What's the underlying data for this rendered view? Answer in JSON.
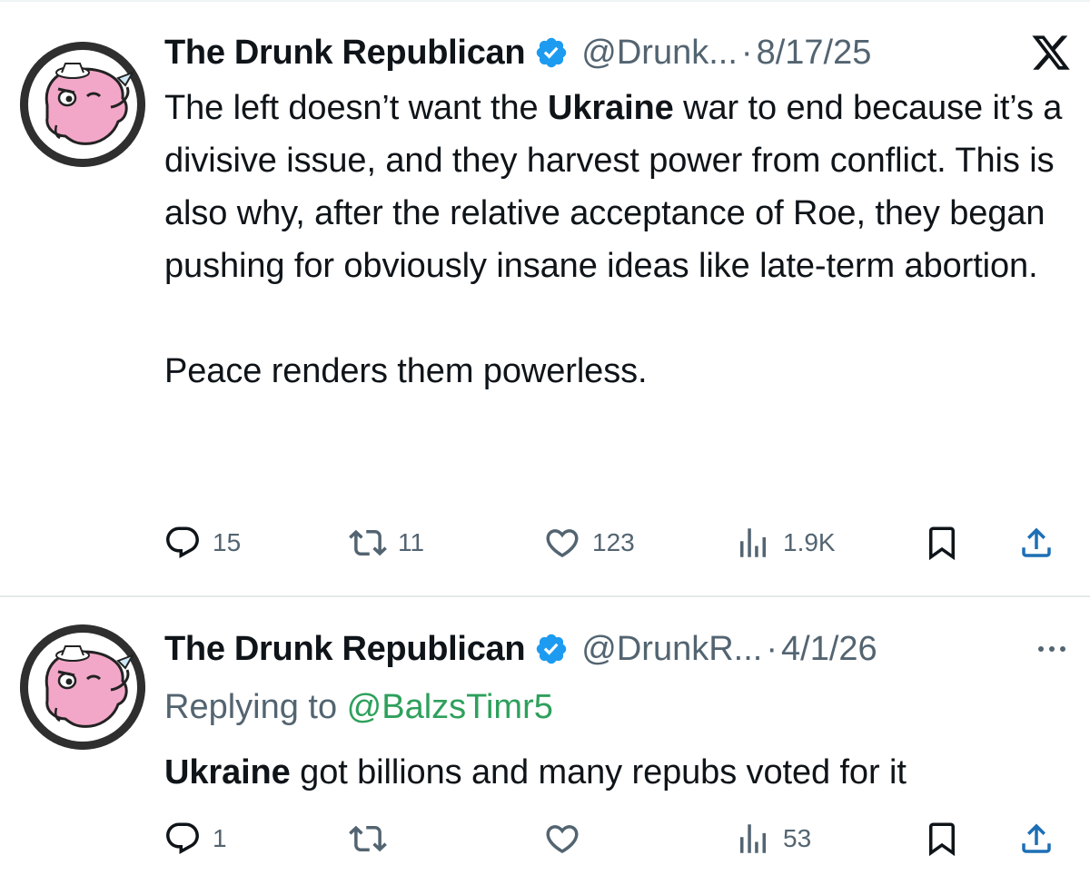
{
  "tweets": [
    {
      "author_name": "The Drunk Republican",
      "handle": "@Drunk...",
      "separator": "·",
      "date": "8/17/25",
      "body": {
        "line1_pre": "The left doesn’t want the ",
        "line1_bold": "Ukraine",
        "line1_post": " war to end because it’s a divisive issue, and they harvest power from conflict. This is also why, after the relative acceptance of Roe, they began pushing for obviously  insane ideas like late-term abortion.",
        "paragraph2": "Peace renders them powerless."
      },
      "stats": {
        "replies": "15",
        "reposts": "11",
        "likes": "123",
        "views": "1.9K"
      }
    },
    {
      "author_name": "The Drunk Republican",
      "handle": "@DrunkR...",
      "separator": "·",
      "date": "4/1/26",
      "replying_to_label": "Replying to ",
      "replying_to_handle": "@BalzsTimr5",
      "body": {
        "bold": "Ukraine",
        "rest": " got billions and many repubs voted for it"
      },
      "stats": {
        "replies": "1",
        "views": "53"
      }
    }
  ],
  "colors": {
    "text": "#0f1419",
    "secondary": "#536471",
    "verified": "#1d9bf0",
    "reply_link": "#2ea05c",
    "avatar_elephant": "#f2a7c8"
  },
  "icons": [
    "reply-icon",
    "retweet-icon",
    "heart-icon",
    "views-icon",
    "bookmark-icon",
    "share-icon",
    "x-logo-icon",
    "more-icon",
    "verified-badge-icon"
  ]
}
